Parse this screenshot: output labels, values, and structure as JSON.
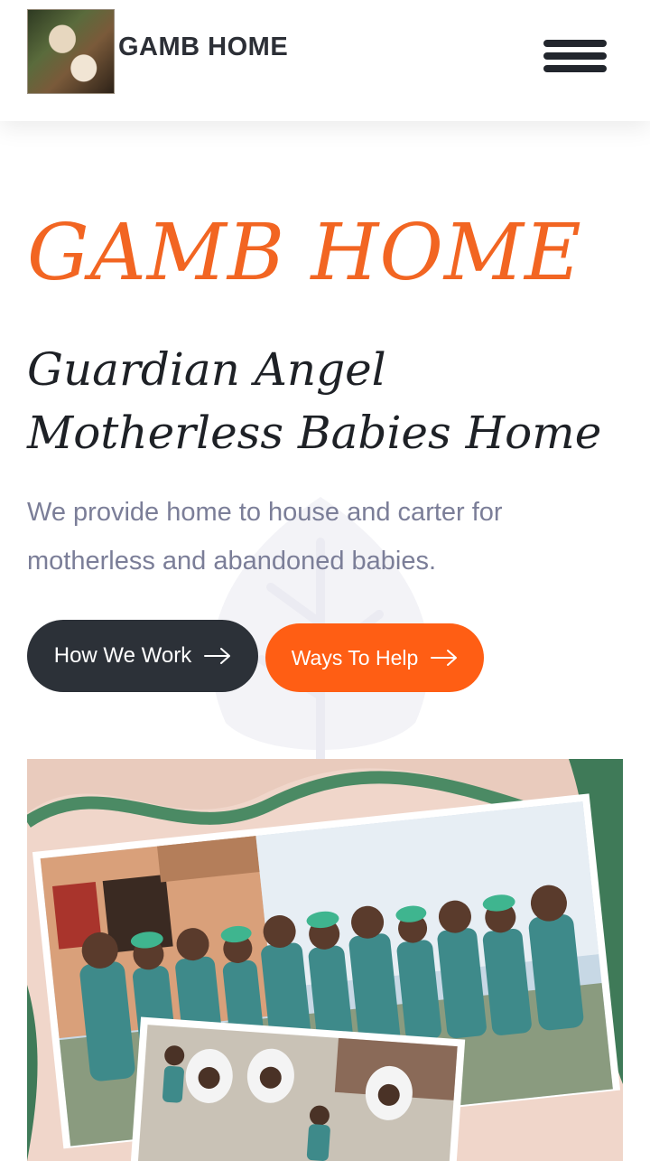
{
  "header": {
    "logo_alt": "GAMB HOME logo",
    "logo_text": "GAMB HOME",
    "menu_icon": "hamburger-menu-icon"
  },
  "hero": {
    "title": "GAMB HOME",
    "subtitle": "Guardian Angel Motherless Babies Home",
    "description": "We provide home to house and carter for motherless and abandoned babies.",
    "buttons": [
      {
        "label": "How We Work",
        "icon": "arrow-right-icon",
        "color": "#2c3138"
      },
      {
        "label": "Ways To Help",
        "icon": "arrow-right-icon",
        "color": "#ff5e14"
      }
    ]
  },
  "photo": {
    "alt": "Children of GAMB HOME in matching outfits with caregivers"
  },
  "colors": {
    "accent": "#f26522",
    "button_dark": "#2c3138",
    "button_orange": "#ff5e14",
    "text_dark": "#1e2126",
    "text_muted": "#7b7e98"
  }
}
